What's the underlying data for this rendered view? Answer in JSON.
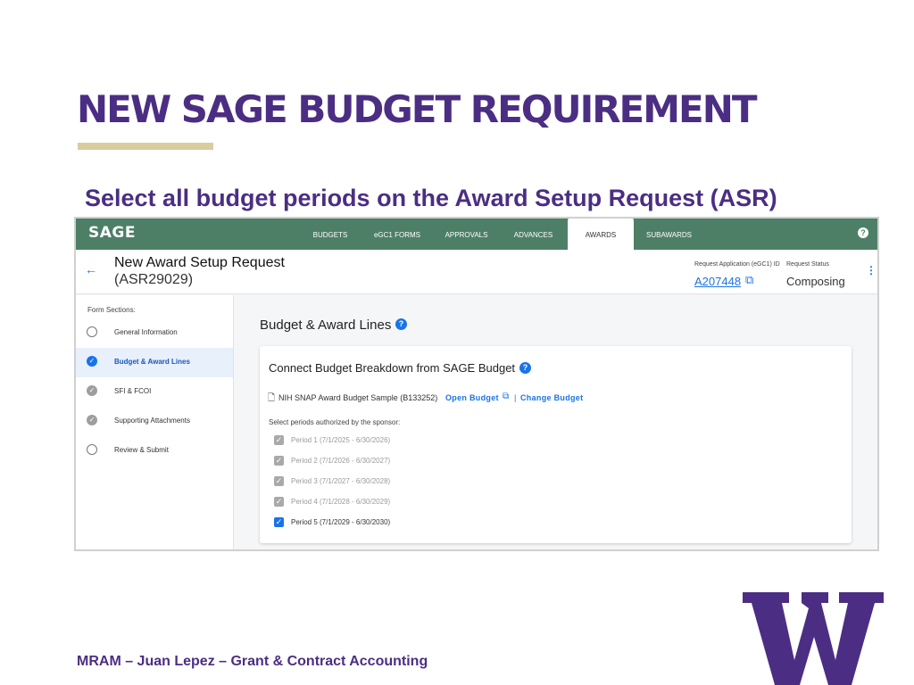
{
  "slide": {
    "title": "NEW SAGE BUDGET REQUIREMENT",
    "subtitle": "Select all budget periods on the Award Setup Request (ASR)",
    "footer": "MRAM – Juan Lepez – Grant & Contract Accounting",
    "logo_letter": "W",
    "colors": {
      "purple": "#4b2e83",
      "gold": "#d8cca0",
      "sage_green": "#4d7f67",
      "link_blue": "#1a73e8"
    }
  },
  "app": {
    "brand": "SAGE",
    "nav": [
      "BUDGETS",
      "eGC1 FORMS",
      "APPROVALS",
      "ADVANCES",
      "AWARDS",
      "SUBAWARDS"
    ],
    "active_nav": "AWARDS",
    "help_icon": "?"
  },
  "header": {
    "title": "New Award Setup Request",
    "asr_id": "(ASR29029)",
    "request_app_label": "Request Application (eGC1) ID",
    "request_app_value": "A207448",
    "status_label": "Request Status",
    "status_value": "Composing"
  },
  "sidebar": {
    "heading": "Form Sections:",
    "items": [
      {
        "label": "General Information",
        "state": "empty",
        "icon": "circle-empty-icon"
      },
      {
        "label": "Budget & Award Lines",
        "state": "active",
        "icon": "check-circle-icon"
      },
      {
        "label": "SFI & FCOI",
        "state": "done",
        "icon": "check-circle-icon"
      },
      {
        "label": "Supporting Attachments",
        "state": "done",
        "icon": "check-circle-icon"
      },
      {
        "label": "Review & Submit",
        "state": "empty",
        "icon": "circle-empty-icon"
      }
    ]
  },
  "main": {
    "section_title": "Budget & Award Lines",
    "card": {
      "title": "Connect Budget Breakdown from SAGE Budget",
      "budget_name": "NIH SNAP Award Budget Sample (B133252)",
      "open_budget": "Open Budget",
      "separator": "|",
      "change_budget": "Change Budget",
      "periods_label": "Select periods authorized by the sponsor:",
      "periods": [
        {
          "label": "Period 1 (7/1/2025 - 6/30/2026)",
          "checked": true,
          "disabled": true
        },
        {
          "label": "Period 2 (7/1/2026 - 6/30/2027)",
          "checked": true,
          "disabled": true
        },
        {
          "label": "Period 3 (7/1/2027 - 6/30/2028)",
          "checked": true,
          "disabled": true
        },
        {
          "label": "Period 4 (7/1/2028 - 6/30/2029)",
          "checked": true,
          "disabled": true
        },
        {
          "label": "Period 5 (7/1/2029 - 6/30/2030)",
          "checked": true,
          "disabled": false
        }
      ]
    }
  }
}
